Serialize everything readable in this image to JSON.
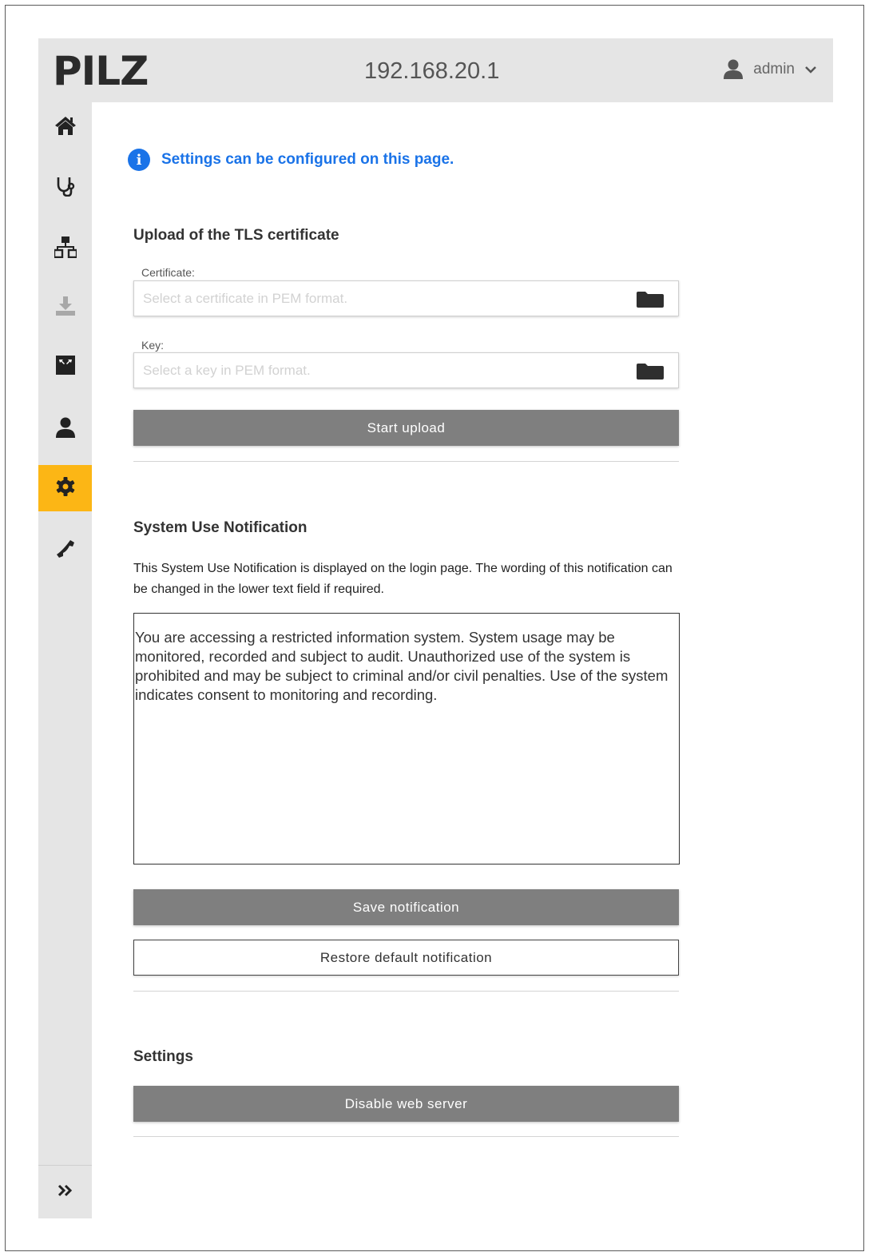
{
  "header": {
    "logo": "PILZ",
    "ip_address": "192.168.20.1",
    "user": "admin"
  },
  "sidebar": {
    "items": [
      {
        "icon": "home-icon",
        "label": "home"
      },
      {
        "icon": "stethoscope-icon",
        "label": "diagnostics"
      },
      {
        "icon": "network-icon",
        "label": "network"
      },
      {
        "icon": "download-icon",
        "label": "download"
      },
      {
        "icon": "expand-icon",
        "label": "expand"
      },
      {
        "icon": "user-icon",
        "label": "users"
      },
      {
        "icon": "gear-icon",
        "label": "settings",
        "active": true
      },
      {
        "icon": "phone-icon",
        "label": "contact"
      }
    ],
    "active_color": "#fcb615"
  },
  "info_message": "Settings can be configured on this page.",
  "tls": {
    "title": "Upload of the TLS certificate",
    "certificate_label": "Certificate:",
    "certificate_placeholder": "Select a certificate in PEM format.",
    "key_label": "Key:",
    "key_placeholder": "Select a key in PEM format.",
    "upload_button": "Start upload"
  },
  "notification": {
    "title": "System Use Notification",
    "description": "This System Use Notification is displayed on the login page. The wording of this notification can be changed in the lower text field if required.",
    "text": "You are accessing a restricted information system. System usage may be monitored, recorded and subject to audit. Unauthorized use of the system is prohibited and may be subject to criminal and/or civil penalties. Use of the system indicates consent to monitoring and recording.",
    "save_button": "Save notification",
    "restore_button": "Restore default notification"
  },
  "settings": {
    "title": "Settings",
    "disable_button": "Disable web server"
  },
  "colors": {
    "info_blue": "#1a73e8",
    "button_gray": "#7f7f7f",
    "header_gray": "#e5e5e5"
  }
}
